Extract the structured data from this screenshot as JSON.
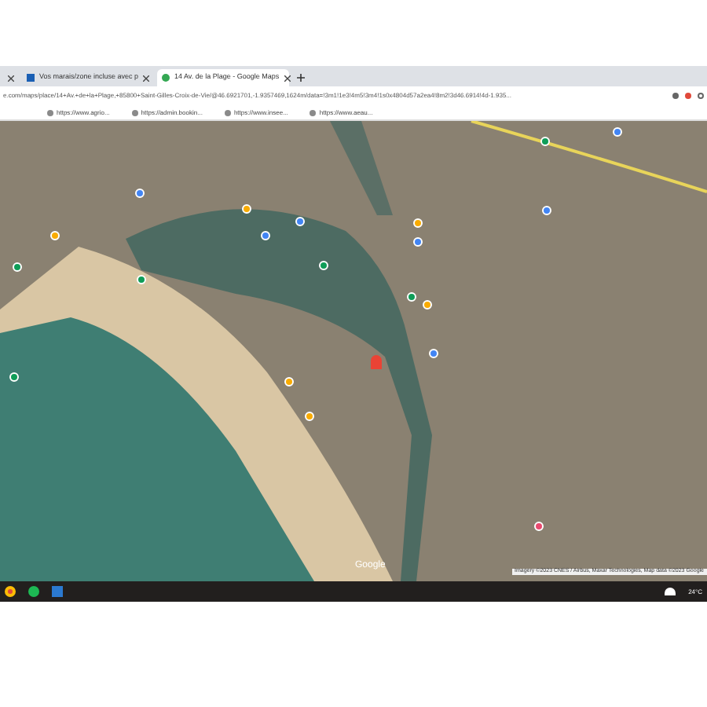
{
  "tabs": [
    {
      "selected": false
    },
    {
      "title": "Vos marais/zone incluse avec p",
      "selected": false
    },
    {
      "title": "14 Av. de la Plage - Google Maps",
      "selected": true
    }
  ],
  "address_bar": {
    "url": "e.com/maps/place/14+Av.+de+la+Plage,+85800+Saint-Gilles-Croix-de-Vie/@46.6921701,-1.9357469,1624m/data=!3m1!1e3!4m5!3m4!1s0x4804d57a2ea4!8m2!3d46.6914!4d-1.935..."
  },
  "bookmarks": [
    {
      "label": "https://www.agrio..."
    },
    {
      "label": "https://admin.bookin..."
    },
    {
      "label": "https://www.insee..."
    },
    {
      "label": "https://www.aeau..."
    }
  ],
  "map": {
    "logo": "Google",
    "attribution": "Imagery ©2023 CNES / Airbus, Maxar Technologies, Map data ©2023 Google"
  },
  "taskbar": {
    "temperature": "24°C"
  }
}
